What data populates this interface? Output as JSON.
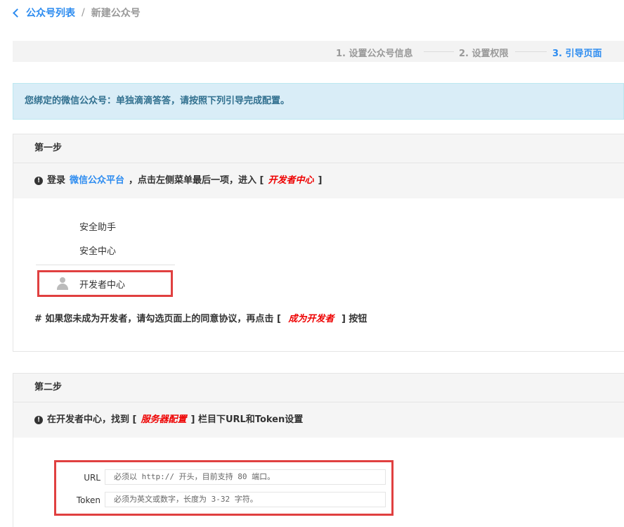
{
  "breadcrumb": {
    "back_label": "公众号列表",
    "separator": "/",
    "current": "新建公众号"
  },
  "steps": [
    {
      "label": "1. 设置公众号信息",
      "active": false
    },
    {
      "label": "2. 设置权限",
      "active": false
    },
    {
      "label": "3. 引导页面",
      "active": true
    }
  ],
  "alert": {
    "text": "您绑定的微信公众号：单独滴滴答答，请按照下列引导完成配置。"
  },
  "step1": {
    "title": "第一步",
    "instr_prefix": "登录",
    "instr_link": "微信公众平台",
    "instr_mid": "，点击左侧菜单最后一项，进入 [",
    "instr_em": "开发者中心",
    "instr_suffix": "]",
    "menu_items": [
      "安全助手",
      "安全中心",
      "开发者中心"
    ],
    "note_prefix": "# 如果您未成为开发者，请勾选页面上的同意协议，再点击 [",
    "note_em": "成为开发者",
    "note_suffix": "] 按钮"
  },
  "step2": {
    "title": "第二步",
    "instr_prefix": "在开发者中心，找到 [",
    "instr_em": "服务器配置",
    "instr_suffix": "] 栏目下URL和Token设置",
    "fields": [
      {
        "label": "URL",
        "value": "必须以 http:// 开头，目前支持 80 端口。"
      },
      {
        "label": "Token",
        "value": "必须为英文或数字，长度为 3-32 字符。"
      }
    ]
  },
  "colors": {
    "primary": "#2d8cf0",
    "emphasis": "#e00000",
    "highlight_box": "#e04040",
    "alert_bg": "#d9edf7",
    "alert_text": "#31708f"
  },
  "icons": {
    "back": "chevron-left-icon",
    "info": "info-circle-icon",
    "user": "user-icon"
  }
}
